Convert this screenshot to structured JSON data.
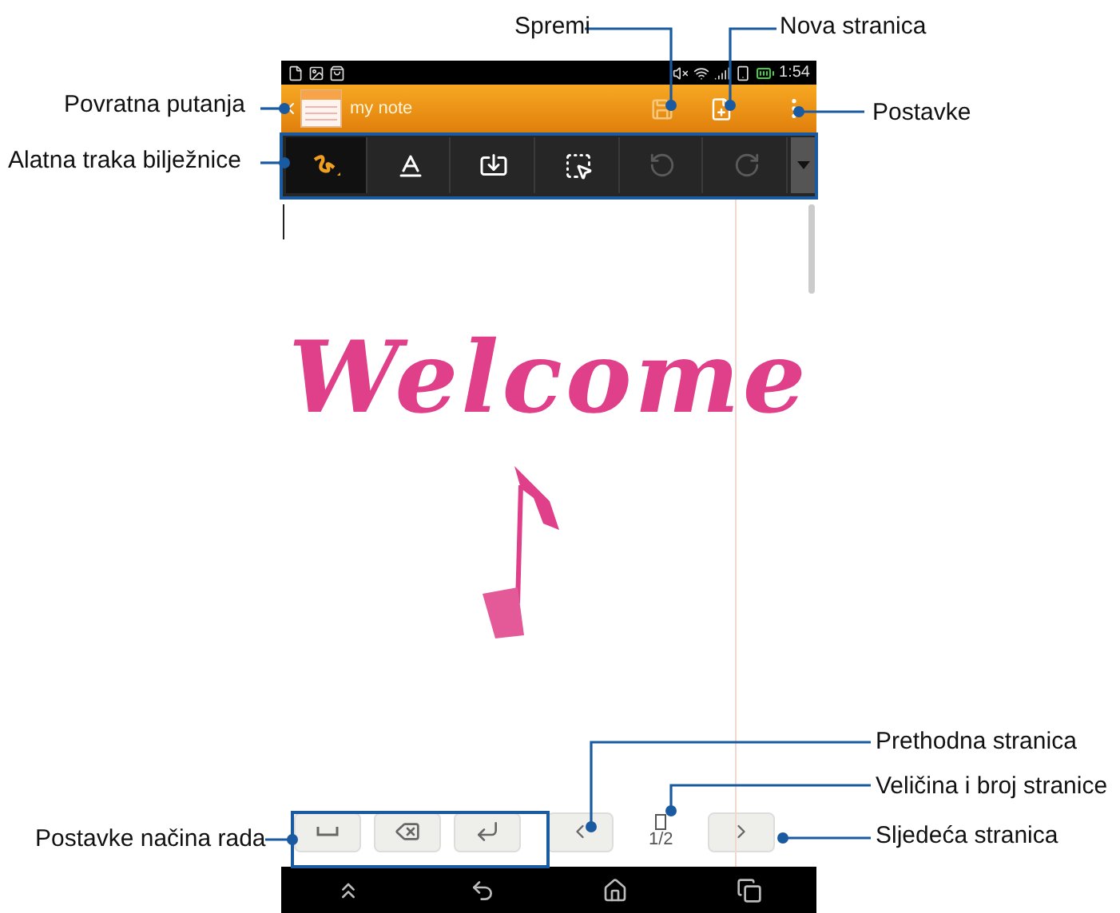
{
  "status_bar": {
    "time": "1:54"
  },
  "action_bar": {
    "title": "my note",
    "save_disabled": true
  },
  "toolbar": {
    "tools": [
      {
        "kind": "pen",
        "selected": true,
        "disabled": false
      },
      {
        "kind": "text",
        "selected": false,
        "disabled": false
      },
      {
        "kind": "insert",
        "selected": false,
        "disabled": false
      },
      {
        "kind": "select",
        "selected": false,
        "disabled": false
      },
      {
        "kind": "undo",
        "selected": false,
        "disabled": true
      },
      {
        "kind": "redo",
        "selected": false,
        "disabled": true
      }
    ]
  },
  "note": {
    "text": "Welcome"
  },
  "mode_buttons": [
    {
      "kind": "space"
    },
    {
      "kind": "backspace"
    },
    {
      "kind": "enter"
    }
  ],
  "page_nav": {
    "page": "1/2"
  },
  "callouts": [
    {
      "label": "Spremi"
    },
    {
      "label": "Nova stranica"
    },
    {
      "label": "Povratna putanja"
    },
    {
      "label": "Postavke"
    },
    {
      "label": "Alatna traka bilježnice"
    },
    {
      "label": "Prethodna stranica"
    },
    {
      "label": "Veličina i broj stranice"
    },
    {
      "label": "Postavke načina rada"
    },
    {
      "label": "Sljedeća stranica"
    }
  ]
}
